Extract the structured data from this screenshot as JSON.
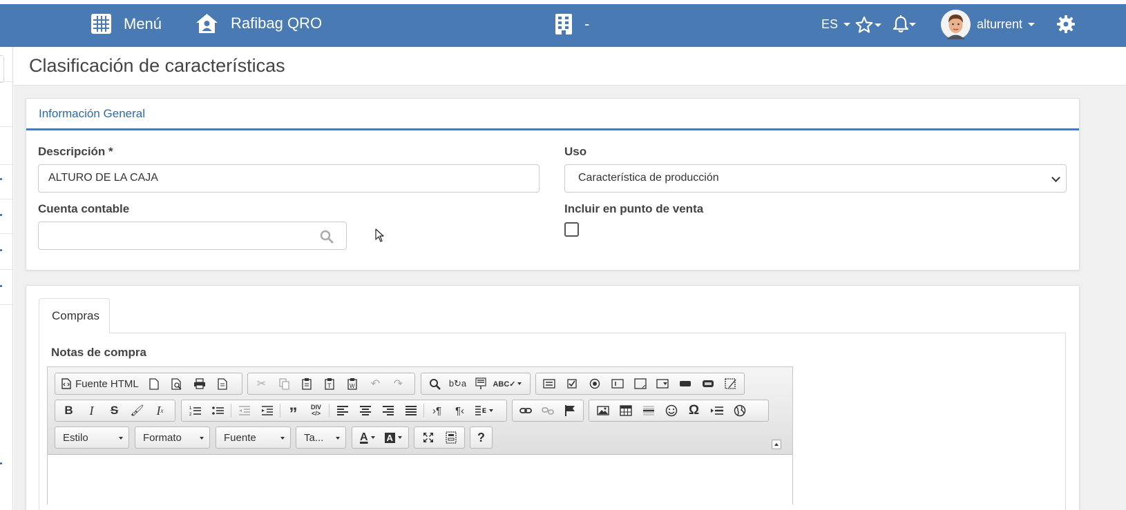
{
  "topbar": {
    "menu_label": "Menú",
    "company_name": "Rafibag QRO",
    "branch_value": "-",
    "language": "ES",
    "username": "alturrent",
    "accent_color": "#4a7ab3"
  },
  "page": {
    "title": "Clasificación de características"
  },
  "general": {
    "header": "Información General",
    "descripcion_label": "Descripción *",
    "descripcion_value": "ALTURO DE LA CAJA",
    "uso_label": "Uso",
    "uso_value": "Característica de producción",
    "cuenta_label": "Cuenta contable",
    "cuenta_value": "",
    "incluir_label": "Incluir en punto de venta",
    "incluir_checked": false
  },
  "tabs": [
    {
      "label": "Compras",
      "active": true
    }
  ],
  "compras": {
    "notas_label": "Notas de compra",
    "editor": {
      "source_button": "Fuente HTML",
      "style_combo": "Estilo",
      "format_combo": "Formato",
      "font_combo": "Fuente",
      "size_combo": "Ta...",
      "help_symbol": "?"
    }
  }
}
